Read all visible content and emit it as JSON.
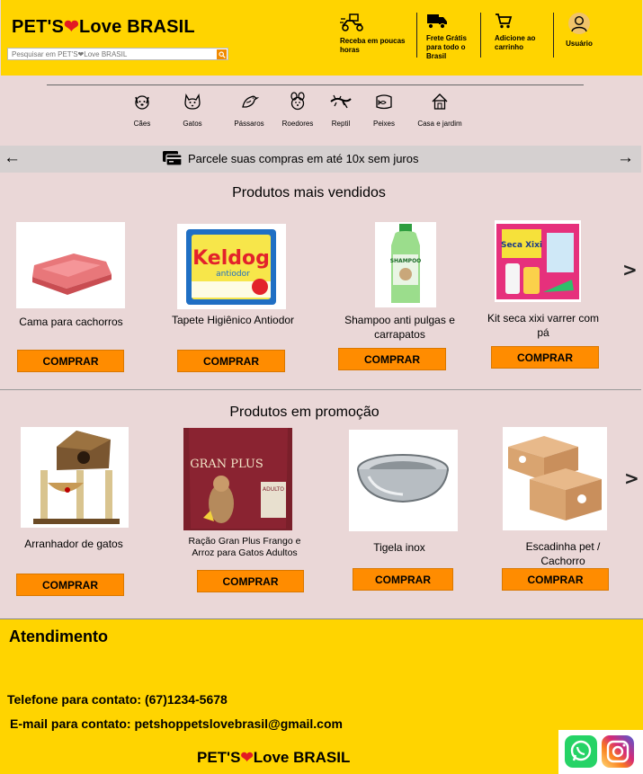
{
  "header": {
    "brand_prefix": "PET'S",
    "brand_heart": "❤",
    "brand_suffix": "Love BRASIL",
    "search_placeholder": "Pesquisar em PET'S❤Love BRASIL",
    "items": [
      {
        "label": "Receba em poucas horas",
        "icon": "delivery-scooter-icon"
      },
      {
        "label": "Frete Grátis para todo o Brasil",
        "icon": "truck-icon"
      },
      {
        "label": "Adicione ao carrinho",
        "icon": "cart-icon"
      },
      {
        "label": "Usuário",
        "icon": "user-icon"
      }
    ]
  },
  "categories": [
    {
      "label": "Cães",
      "icon": "dog-icon"
    },
    {
      "label": "Gatos",
      "icon": "cat-icon"
    },
    {
      "label": "Pássaros",
      "icon": "bird-icon"
    },
    {
      "label": "Roedores",
      "icon": "rodent-icon"
    },
    {
      "label": "Reptil",
      "icon": "reptile-icon"
    },
    {
      "label": "Peixes",
      "icon": "fish-icon"
    },
    {
      "label": "Casa e jardim",
      "icon": "house-icon"
    }
  ],
  "banner": {
    "text": "Parcele  suas compras em até 10x sem juros",
    "prev": "←",
    "next": "→"
  },
  "best_sellers": {
    "title": "Produtos mais vendidos",
    "products": [
      {
        "name": "Cama para cachorros",
        "button": "COMPRAR"
      },
      {
        "name": "Tapete Higiênico Antiodor",
        "button": "COMPRAR"
      },
      {
        "name": "Shampoo anti pulgas e carrapatos",
        "button": "COMPRAR"
      },
      {
        "name": "Kit seca xixi varrer com pá",
        "button": "COMPRAR"
      }
    ],
    "next": ">"
  },
  "promotions": {
    "title": "Produtos em promoção",
    "products": [
      {
        "name": "Arranhador de gatos",
        "button": "COMPRAR"
      },
      {
        "name": "Ração Gran Plus Frango e Arroz para Gatos Adultos",
        "button": "COMPRAR"
      },
      {
        "name": "Tigela inox",
        "button": "COMPRAR"
      },
      {
        "name": "Escadinha pet / Cachorro",
        "button": "COMPRAR"
      }
    ],
    "next": ">"
  },
  "footer": {
    "title": "Atendimento",
    "phone": "Telefone para contato: (67)1234-5678",
    "email": "E-mail para contato: petshoppetslovebrasil@gmail.com",
    "brand_prefix": "PET'S",
    "brand_heart": "❤",
    "brand_suffix": "Love BRASIL"
  },
  "product_images": {
    "keldog_brand": "Keldog",
    "keldog_sub": "antiodor",
    "shampoo_label": "SHAMPOO",
    "kit_brand": "Seca Xixi",
    "granplus_brand": "GRAN PLUS",
    "granplus_variant": "ADULTO"
  },
  "colors": {
    "yellow": "#ffd400",
    "orange": "#ff8c00",
    "pink_bg": "#ead7d7",
    "heart": "#e31b23"
  }
}
